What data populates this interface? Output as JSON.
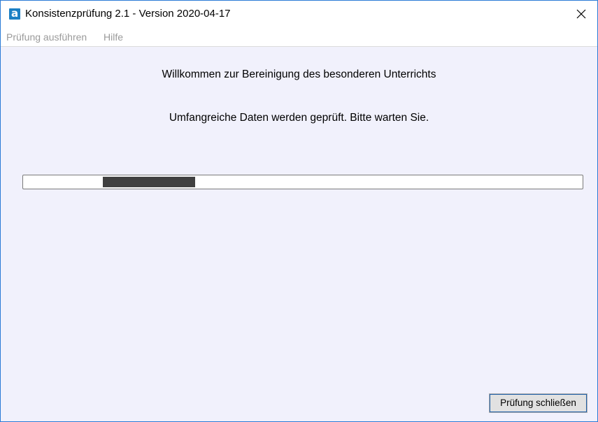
{
  "window": {
    "title": "Konsistenzprüfung 2.1 - Version 2020-04-17",
    "app_icon_letter": "a"
  },
  "menu": {
    "items": [
      {
        "label": "Prüfung ausführen"
      },
      {
        "label": "Hilfe"
      }
    ]
  },
  "main": {
    "heading": "Willkommen zur Bereinigung des besonderen Unterrichts",
    "status": "Umfangreiche Daten werden geprüft. Bitte warten Sie."
  },
  "footer": {
    "close_button_label": "Prüfung schließen"
  },
  "colors": {
    "background": "#f1f1fc",
    "accent": "#1a7fc4",
    "progress_marquee": "#404040"
  },
  "icons": {
    "app": "app-logo-icon",
    "close": "close-icon"
  }
}
